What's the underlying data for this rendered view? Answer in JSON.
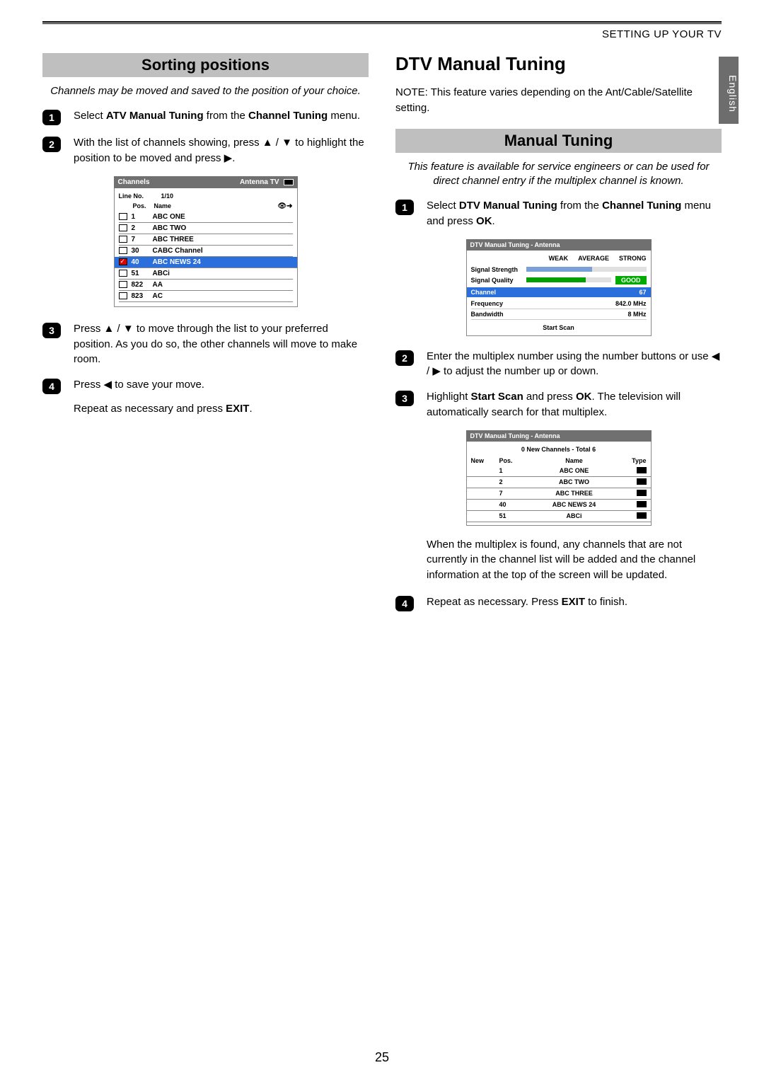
{
  "header": {
    "section": "SETTING UP YOUR TV",
    "language_tab": "English"
  },
  "page_number": "25",
  "left": {
    "title": "Sorting positions",
    "intro": "Channels may be moved and saved to the position of your choice.",
    "steps": {
      "s1": {
        "pre": "Select ",
        "b1": "ATV Manual Tuning",
        "mid": " from the ",
        "b2": "Channel Tuning",
        "post": " menu."
      },
      "s2": {
        "pre": "With the list of channels showing, press ",
        "arrows": "▲ / ▼",
        "mid": " to highlight the position to be moved and press ",
        "arrow2": "▶",
        "post": "."
      },
      "s3": {
        "pre": "Press ",
        "arrows": "▲ / ▼",
        "post": " to move through the list to your preferred position. As you do so, the other channels will move to make room."
      },
      "s4a": {
        "pre": "Press ",
        "arrow": "◀",
        "post": " to save your move."
      },
      "s4b": {
        "pre": "Repeat as necessary and press ",
        "b": "EXIT",
        "post": "."
      }
    },
    "osd": {
      "title_left": "Channels",
      "title_right": "Antenna TV",
      "line_no_label": "Line No.",
      "line_no_value": "1/10",
      "col_pos": "Pos.",
      "col_name": "Name",
      "highlighted_index": 4,
      "rows": [
        {
          "pos": "1",
          "name": "ABC ONE"
        },
        {
          "pos": "2",
          "name": "ABC TWO"
        },
        {
          "pos": "7",
          "name": "ABC THREE"
        },
        {
          "pos": "30",
          "name": "CABC Channel"
        },
        {
          "pos": "40",
          "name": "ABC NEWS 24"
        },
        {
          "pos": "51",
          "name": "ABCi"
        },
        {
          "pos": "822",
          "name": "AA"
        },
        {
          "pos": "823",
          "name": "AC"
        }
      ]
    }
  },
  "right": {
    "main_title": "DTV Manual Tuning",
    "note": {
      "lead": "NOTE:",
      "text": " This feature varies depending on the ",
      "b1": "Ant",
      "sep1": "/",
      "b2": "Cable",
      "sep2": "/",
      "b3": "Satellite",
      "post": " setting."
    },
    "sub_title": "Manual Tuning",
    "intro": "This feature is available for service engineers or can be used for direct channel entry if the multiplex channel is known.",
    "steps": {
      "s1": {
        "pre": "Select ",
        "b1": "DTV Manual Tuning",
        "mid": " from the ",
        "b2": "Channel Tuning",
        "mid2": " menu and press ",
        "b3": "OK",
        "post": "."
      },
      "s2": {
        "pre": "Enter the multiplex number using the number buttons or use ",
        "arrows": "◀ / ▶",
        "post": " to adjust the number up or down."
      },
      "s3": {
        "pre": "Highlight ",
        "b1": "Start Scan",
        "mid": " and press ",
        "b2": "OK",
        "post": ". The television will automatically search for that multiplex."
      },
      "found_text": "When the multiplex is found, any channels that are not currently in the channel list will be added and the channel information at the top of the screen will be updated.",
      "s4": {
        "pre": "Repeat as necessary. Press ",
        "b": "EXIT",
        "post": " to finish."
      }
    },
    "osd1": {
      "title": "DTV Manual Tuning - Antenna",
      "weak": "WEAK",
      "average": "AVERAGE",
      "strong": "STRONG",
      "signal_strength": "Signal Strength",
      "signal_quality": "Signal Quality",
      "quality_value": "GOOD",
      "strength_color": "#7aa0d8",
      "strength_pct": 55,
      "quality_color": "#00a000",
      "quality_pct": 70,
      "channel_label": "Channel",
      "channel_value": "67",
      "frequency_label": "Frequency",
      "frequency_value": "842.0 MHz",
      "bandwidth_label": "Bandwidth",
      "bandwidth_value": "8 MHz",
      "start_scan": "Start Scan"
    },
    "osd2": {
      "title": "DTV Manual Tuning - Antenna",
      "subtitle": "0 New Channels - Total 6",
      "col_new": "New",
      "col_pos": "Pos.",
      "col_name": "Name",
      "col_type": "Type",
      "rows": [
        {
          "pos": "1",
          "name": "ABC ONE"
        },
        {
          "pos": "2",
          "name": "ABC TWO"
        },
        {
          "pos": "7",
          "name": "ABC THREE"
        },
        {
          "pos": "40",
          "name": "ABC NEWS 24"
        },
        {
          "pos": "51",
          "name": "ABCi"
        }
      ]
    }
  }
}
